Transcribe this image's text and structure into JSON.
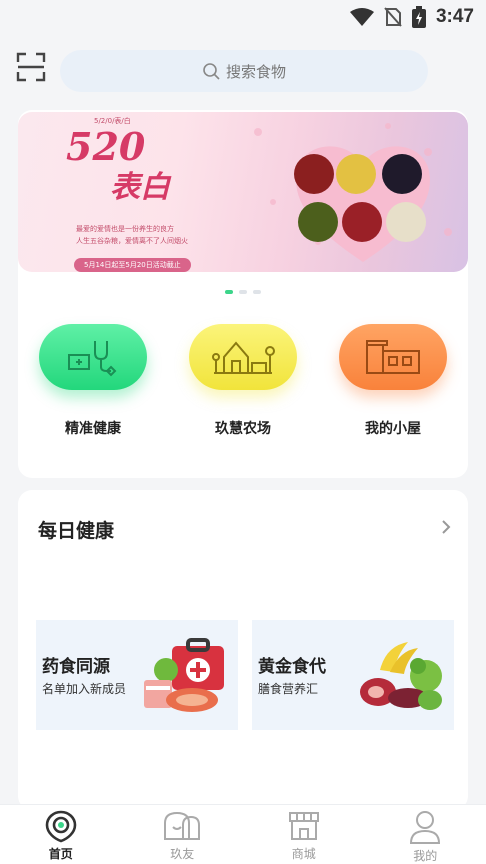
{
  "status": {
    "time": "3:47"
  },
  "search": {
    "placeholder": "搜索食物"
  },
  "banner": {
    "headline_a": "520",
    "headline_b": "表白",
    "small_text": "5/2/0/表/白",
    "slogan_line1": "最爱的爱情也是一份养生的良方",
    "slogan_line2": "人生五谷杂粮，爱情离不了人间烟火",
    "date_note": "5月14日起至5月20日活动截止"
  },
  "carousel": {
    "count": 3,
    "active": 0
  },
  "features": [
    {
      "label": "精准健康",
      "icon": "health-monitor-icon",
      "color": "#23d77c"
    },
    {
      "label": "玖慧农场",
      "icon": "farm-icon",
      "color": "#f1e43b"
    },
    {
      "label": "我的小屋",
      "icon": "cabin-icon",
      "color": "#f9823b"
    }
  ],
  "daily": {
    "title": "每日健康",
    "tiles": [
      {
        "title": "药食同源",
        "subtitle": "名单加入新成员"
      },
      {
        "title": "黄金食代",
        "subtitle": "膳食营养汇"
      }
    ]
  },
  "tabs": [
    {
      "label": "首页",
      "icon": "home-icon",
      "active": true
    },
    {
      "label": "玖友",
      "icon": "friends-icon",
      "active": false
    },
    {
      "label": "商城",
      "icon": "store-icon",
      "active": false
    },
    {
      "label": "我的",
      "icon": "profile-icon",
      "active": false
    }
  ],
  "colors": {
    "accent": "#3cd58a",
    "search_bg": "#e9f0f8",
    "tile_bg": "#eef4fb"
  }
}
